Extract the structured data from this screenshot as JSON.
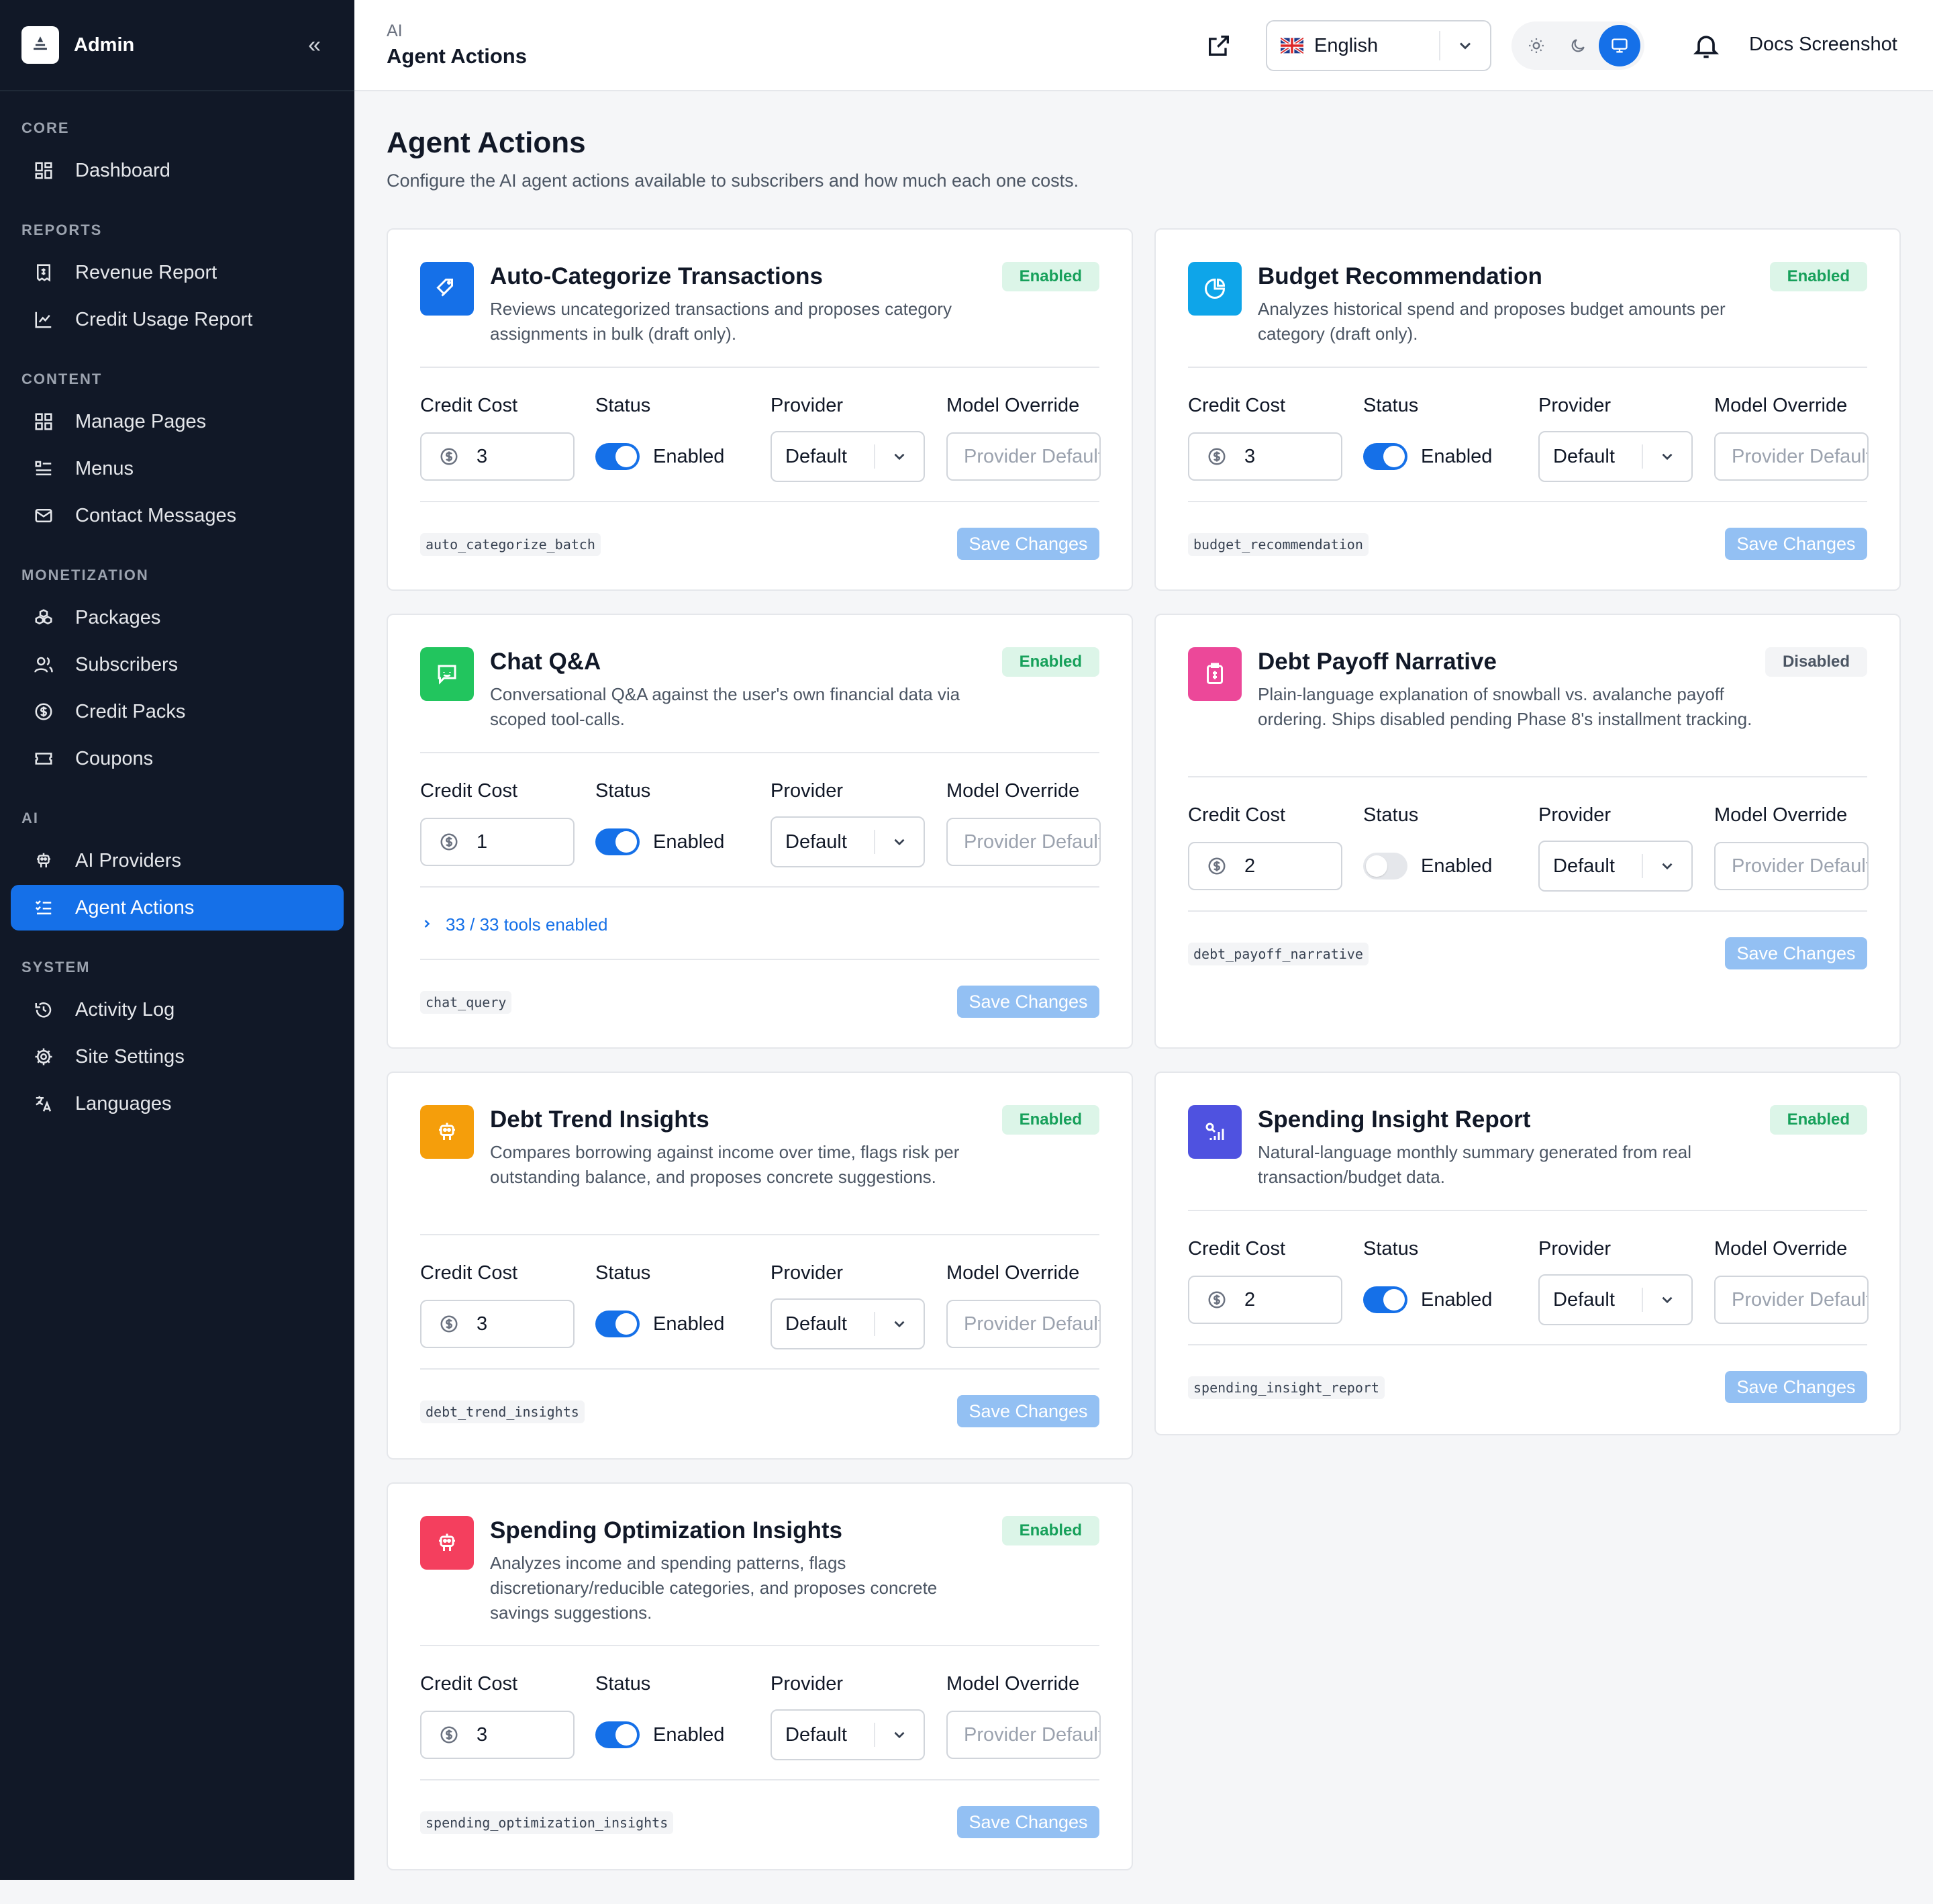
{
  "sidebar": {
    "title": "Admin",
    "sections": [
      {
        "label": "CORE",
        "items": [
          {
            "label": "Dashboard",
            "icon": "dashboard-icon"
          }
        ]
      },
      {
        "label": "REPORTS",
        "items": [
          {
            "label": "Revenue Report",
            "icon": "receipt-icon"
          },
          {
            "label": "Credit Usage Report",
            "icon": "chart-icon"
          }
        ]
      },
      {
        "label": "CONTENT",
        "items": [
          {
            "label": "Manage Pages",
            "icon": "grid-icon"
          },
          {
            "label": "Menus",
            "icon": "menu-icon"
          },
          {
            "label": "Contact Messages",
            "icon": "mail-icon"
          }
        ]
      },
      {
        "label": "MONETIZATION",
        "items": [
          {
            "label": "Packages",
            "icon": "boxes-icon"
          },
          {
            "label": "Subscribers",
            "icon": "users-icon"
          },
          {
            "label": "Credit Packs",
            "icon": "dollar-icon"
          },
          {
            "label": "Coupons",
            "icon": "ticket-icon"
          }
        ]
      },
      {
        "label": "AI",
        "items": [
          {
            "label": "AI Providers",
            "icon": "robot-icon"
          },
          {
            "label": "Agent Actions",
            "icon": "list-check-icon",
            "active": true
          }
        ]
      },
      {
        "label": "SYSTEM",
        "items": [
          {
            "label": "Activity Log",
            "icon": "history-icon"
          },
          {
            "label": "Site Settings",
            "icon": "gear-icon"
          },
          {
            "label": "Languages",
            "icon": "translate-icon"
          }
        ]
      }
    ]
  },
  "topbar": {
    "crumb_small": "AI",
    "crumb_main": "Agent Actions",
    "language": "English",
    "user": "Docs Screenshot"
  },
  "page": {
    "title": "Agent Actions",
    "subtitle": "Configure the AI agent actions available to subscribers and how much each one costs."
  },
  "labels": {
    "credit_cost": "Credit Cost",
    "status": "Status",
    "provider": "Provider",
    "model_override": "Model Override",
    "save": "Save Changes",
    "model_placeholder": "Provider Default",
    "enabled": "Enabled"
  },
  "colors": {
    "accent": "#1570e8",
    "sidebar_bg": "#111827"
  },
  "cards": [
    {
      "title": "Auto-Categorize Transactions",
      "desc": "Reviews uncategorized transactions and proposes category assignments in bulk (draft only).",
      "badge": "Enabled",
      "enabled": true,
      "cost": "3",
      "provider": "Default",
      "slug": "auto_categorize_batch",
      "icon_color": "#1570e8",
      "icon": "tags-icon"
    },
    {
      "title": "Budget Recommendation",
      "desc": "Analyzes historical spend and proposes budget amounts per category (draft only).",
      "badge": "Enabled",
      "enabled": true,
      "cost": "3",
      "provider": "Default",
      "slug": "budget_recommendation",
      "icon_color": "#0ea5e9",
      "icon": "pie-chart-icon"
    },
    {
      "title": "Chat Q&A",
      "desc": "Conversational Q&A against the user's own financial data via scoped tool-calls.",
      "badge": "Enabled",
      "enabled": true,
      "cost": "1",
      "provider": "Default",
      "slug": "chat_query",
      "icon_color": "#22c55e",
      "icon": "chat-icon",
      "tools": "33 / 33 tools enabled"
    },
    {
      "title": "Debt Payoff Narrative",
      "desc": "Plain-language explanation of snowball vs. avalanche payoff ordering. Ships disabled pending Phase 8's installment tracking.",
      "badge": "Disabled",
      "enabled": false,
      "cost": "2",
      "provider": "Default",
      "slug": "debt_payoff_narrative",
      "icon_color": "#ec4899",
      "icon": "receipt-icon"
    },
    {
      "title": "Debt Trend Insights",
      "desc": "Compares borrowing against income over time, flags risk per outstanding balance, and proposes concrete suggestions.",
      "badge": "Enabled",
      "enabled": true,
      "cost": "3",
      "provider": "Default",
      "slug": "debt_trend_insights",
      "icon_color": "#f59e0b",
      "icon": "robot-icon"
    },
    {
      "title": "Spending Insight Report",
      "desc": "Natural-language monthly summary generated from real transaction/budget data.",
      "badge": "Enabled",
      "enabled": true,
      "cost": "2",
      "provider": "Default",
      "slug": "spending_insight_report",
      "icon_color": "#4f52e0",
      "icon": "search-chart-icon"
    },
    {
      "title": "Spending Optimization Insights",
      "desc": "Analyzes income and spending patterns, flags discretionary/reducible categories, and proposes concrete savings suggestions.",
      "badge": "Enabled",
      "enabled": true,
      "cost": "3",
      "provider": "Default",
      "slug": "spending_optimization_insights",
      "icon_color": "#f43f5e",
      "icon": "robot-icon"
    }
  ]
}
